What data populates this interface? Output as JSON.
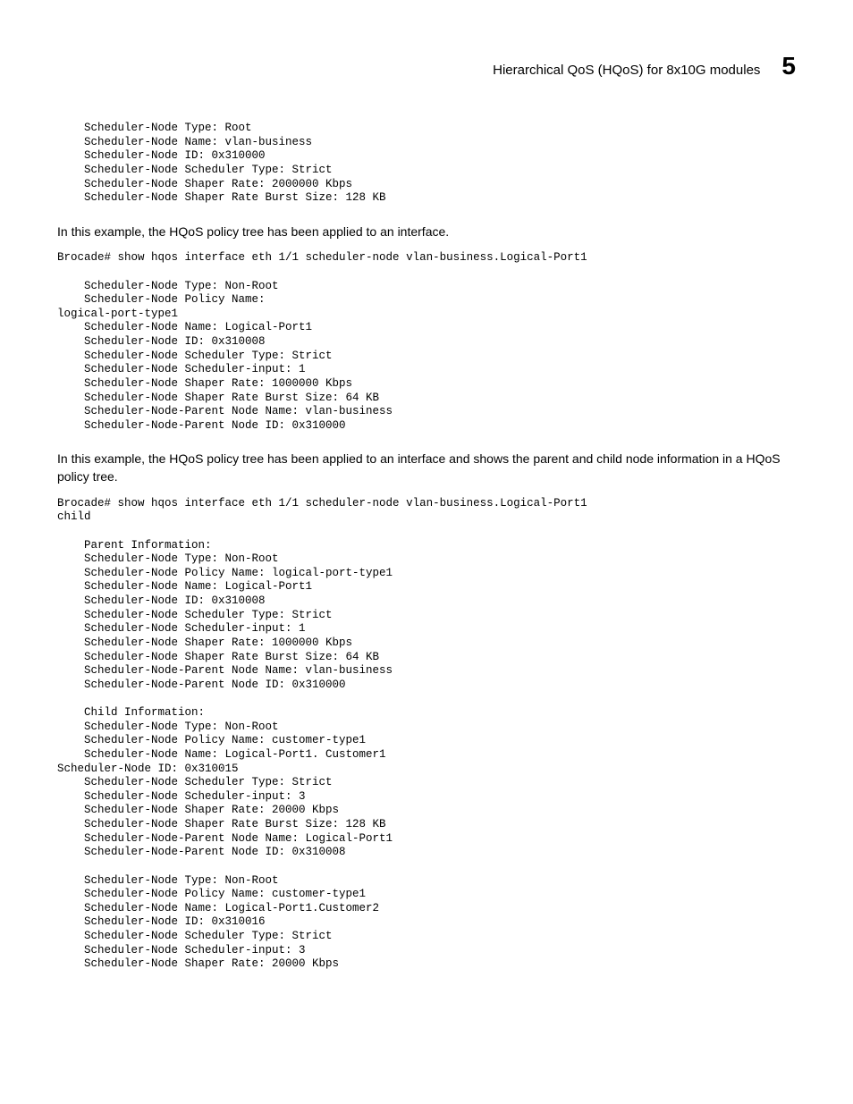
{
  "header": {
    "title": "Hierarchical QoS (HQoS) for 8x10G modules",
    "chapter": "5"
  },
  "block1": "    Scheduler-Node Type: Root\n    Scheduler-Node Name: vlan-business\n    Scheduler-Node ID: 0x310000\n    Scheduler-Node Scheduler Type: Strict\n    Scheduler-Node Shaper Rate: 2000000 Kbps\n    Scheduler-Node Shaper Rate Burst Size: 128 KB",
  "para1": "In this example, the HQoS policy tree has been applied to an interface.",
  "block2": "Brocade# show hqos interface eth 1/1 scheduler-node vlan-business.Logical-Port1\n\n    Scheduler-Node Type: Non-Root\n    Scheduler-Node Policy Name: \nlogical-port-type1\n    Scheduler-Node Name: Logical-Port1\n    Scheduler-Node ID: 0x310008\n    Scheduler-Node Scheduler Type: Strict\n    Scheduler-Node Scheduler-input: 1\n    Scheduler-Node Shaper Rate: 1000000 Kbps\n    Scheduler-Node Shaper Rate Burst Size: 64 KB\n    Scheduler-Node-Parent Node Name: vlan-business\n    Scheduler-Node-Parent Node ID: 0x310000",
  "para2": "In this example, the HQoS policy tree has been applied to an interface and shows the parent and child node information in a HQoS policy tree.",
  "block3": "Brocade# show hqos interface eth 1/1 scheduler-node vlan-business.Logical-Port1 \nchild\n\n    Parent Information:\n    Scheduler-Node Type: Non-Root\n    Scheduler-Node Policy Name: logical-port-type1\n    Scheduler-Node Name: Logical-Port1\n    Scheduler-Node ID: 0x310008\n    Scheduler-Node Scheduler Type: Strict\n    Scheduler-Node Scheduler-input: 1\n    Scheduler-Node Shaper Rate: 1000000 Kbps\n    Scheduler-Node Shaper Rate Burst Size: 64 KB\n    Scheduler-Node-Parent Node Name: vlan-business\n    Scheduler-Node-Parent Node ID: 0x310000\n\n    Child Information:\n    Scheduler-Node Type: Non-Root\n    Scheduler-Node Policy Name: customer-type1\n    Scheduler-Node Name: Logical-Port1. Customer1\nScheduler-Node ID: 0x310015\n    Scheduler-Node Scheduler Type: Strict\n    Scheduler-Node Scheduler-input: 3\n    Scheduler-Node Shaper Rate: 20000 Kbps\n    Scheduler-Node Shaper Rate Burst Size: 128 KB\n    Scheduler-Node-Parent Node Name: Logical-Port1\n    Scheduler-Node-Parent Node ID: 0x310008\n\n    Scheduler-Node Type: Non-Root\n    Scheduler-Node Policy Name: customer-type1\n    Scheduler-Node Name: Logical-Port1.Customer2\n    Scheduler-Node ID: 0x310016\n    Scheduler-Node Scheduler Type: Strict\n    Scheduler-Node Scheduler-input: 3\n    Scheduler-Node Shaper Rate: 20000 Kbps"
}
